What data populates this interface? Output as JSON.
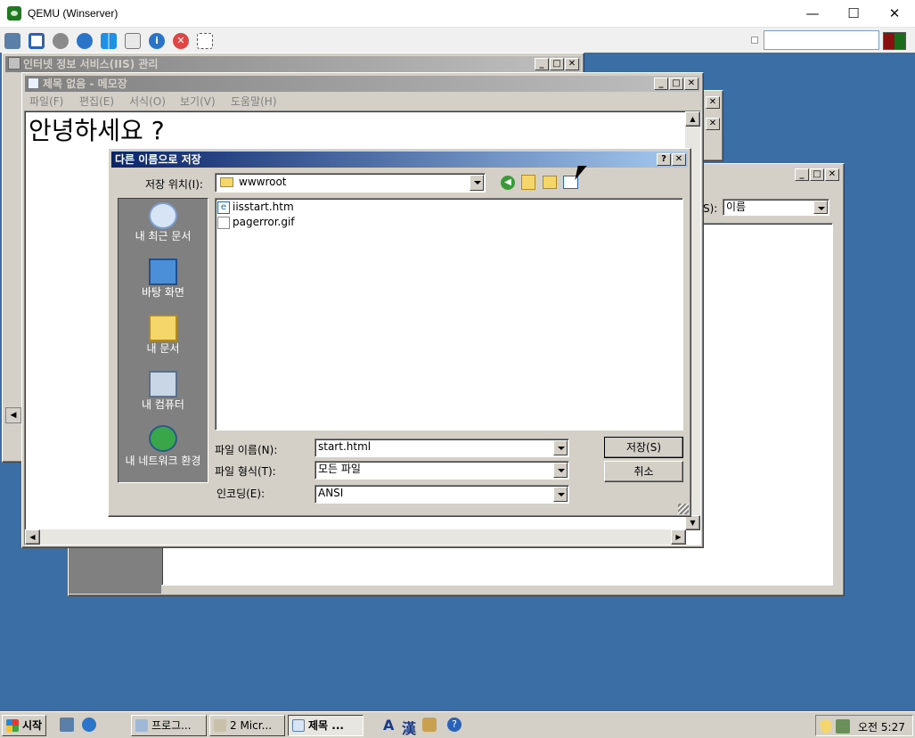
{
  "host": {
    "title": "QEMU (Winserver)",
    "controls": {
      "minimize": "—",
      "maximize": "☐",
      "close": "✕"
    },
    "toolbar_icons": [
      "gears-icon",
      "fullscreen-icon",
      "settings-icon",
      "refresh-icon",
      "windows-icon",
      "disk-icon",
      "info-icon",
      "stop-icon",
      "screenshot-icon"
    ],
    "search_value": ""
  },
  "iis_window": {
    "title": "인터넷 정보 서비스(IIS) 관리"
  },
  "explorer_window": {
    "sort_label": "S):",
    "sort_value": "이름"
  },
  "notepad": {
    "title": "제목 없음 - 메모장",
    "menu": [
      "파일(F)",
      "편집(E)",
      "서식(O)",
      "보기(V)",
      "도움말(H)"
    ],
    "content": "안녕하세요 ?"
  },
  "save_dialog": {
    "title": "다른 이름으로 저장",
    "help_btn": "?",
    "close_btn": "✕",
    "save_in_label": "저장 위치(I):",
    "save_in_value": "wwwroot",
    "places": [
      {
        "label": "내 최근 문서",
        "icon": "recent-documents-icon"
      },
      {
        "label": "바탕 화면",
        "icon": "desktop-icon"
      },
      {
        "label": "내 문서",
        "icon": "my-documents-icon"
      },
      {
        "label": "내 컴퓨터",
        "icon": "my-computer-icon"
      },
      {
        "label": "내 네트워크 환경",
        "icon": "network-places-icon"
      }
    ],
    "files": [
      {
        "name": "iisstart.htm",
        "icon": "html-file-icon"
      },
      {
        "name": "pagerror.gif",
        "icon": "gif-file-icon"
      }
    ],
    "filename_label": "파일 이름(N):",
    "filename_value": "start.html",
    "filetype_label": "파일 형식(T):",
    "filetype_value": "모든 파일",
    "encoding_label": "인코딩(E):",
    "encoding_value": "ANSI",
    "save_button": "저장(S)",
    "cancel_button": "취소"
  },
  "taskbar": {
    "start_label": "시작",
    "tasks": [
      "프로그...",
      "2 Micr...",
      "제목 ..."
    ],
    "ime": {
      "lang": "A",
      "hanja": "漢"
    },
    "clock": "오전 5:27"
  },
  "colors": {
    "desktop": "#3a6ea5",
    "active_title_start": "#0a246a",
    "active_title_end": "#a6caf0",
    "window_face": "#d4d0c8",
    "places_bar": "#808080"
  }
}
